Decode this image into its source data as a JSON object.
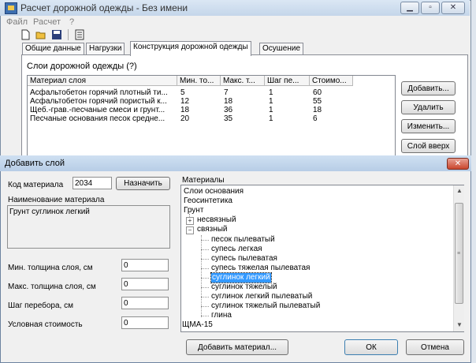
{
  "main_window": {
    "title": "Расчет дорожной одежды - Без имени",
    "menu": [
      "Файл",
      "Расчет",
      "?"
    ],
    "tabs": [
      "Общие данные",
      "Нагрузки",
      "Конструкция дорожной одежды",
      "Осушение"
    ],
    "active_tab": "Конструкция дорожной одежды",
    "layers_label": "Слои дорожной одежды (?)",
    "columns": [
      "Материал слоя",
      "Мин. то...",
      "Макс. т...",
      "Шаг пе...",
      "Стоимо..."
    ],
    "rows": [
      [
        "Асфальтобетон горячий плотный ти...",
        "5",
        "7",
        "1",
        "60"
      ],
      [
        "Асфальтобетон горячий пористый к...",
        "12",
        "18",
        "1",
        "55"
      ],
      [
        "Щеб.-грав.-песчаные смеси и грунт...",
        "18",
        "36",
        "1",
        "18"
      ],
      [
        "Песчаные основания песок средне...",
        "20",
        "35",
        "1",
        "6"
      ]
    ],
    "buttons": {
      "add": "Добавить...",
      "delete": "Удалить",
      "edit": "Изменить...",
      "up": "Слой вверх"
    }
  },
  "dialog": {
    "title": "Добавить слой",
    "code_label": "Код материала",
    "code_value": "2034",
    "assign_button": "Назначить",
    "name_label": "Наименование материала",
    "name_value": "Грунт суглинок легкий",
    "fields": [
      {
        "label": "Мин. толщина слоя, см",
        "value": "0"
      },
      {
        "label": "Макс. толщина слоя, см",
        "value": "0"
      },
      {
        "label": "Шаг перебора, см",
        "value": "0"
      },
      {
        "label": "Условная стоимость",
        "value": "0"
      }
    ],
    "materials_label": "Материалы",
    "materials": [
      "Слои основания",
      "Геосинтетика",
      "Грунт",
      "несвязный",
      "связный",
      "песок пылеватый",
      "супесь легкая",
      "супесь пылеватая",
      "супесь тяжелая пылеватая",
      "суглинок легкий",
      "суглинок тяжелый",
      "суглинок легкий пылеватый",
      "суглинок тяжелый пылеватый",
      "глина",
      "ЩМА-15"
    ],
    "selected_material": "суглинок легкий",
    "add_material_button": "Добавить материал...",
    "ok_button": "ОК",
    "cancel_button": "Отмена"
  }
}
